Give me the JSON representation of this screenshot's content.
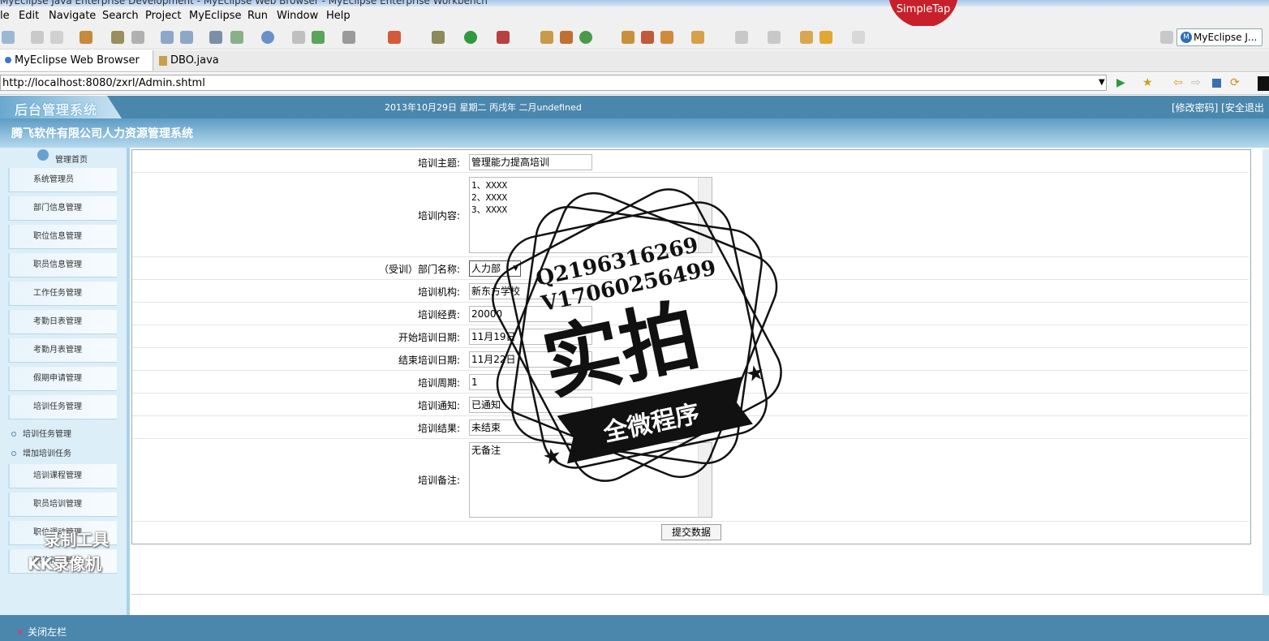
{
  "window": {
    "title": "MyEclipse Java Enterprise Development - MyEclipse Web Browser - MyEclipse Enterprise Workbench"
  },
  "menu": [
    "le",
    "Edit",
    "Navigate",
    "Search",
    "Project",
    "MyEclipse",
    "Run",
    "Window",
    "Help"
  ],
  "simpletap": "SimpleTap",
  "perspective": "MyEclipse J...",
  "tabs": [
    {
      "label": "MyEclipse Web Browser",
      "close": "✕"
    },
    {
      "label": "DBO.java"
    }
  ],
  "address": "http://localhost:8080/zxrl/Admin.shtml",
  "header": {
    "logo": "后台管理系统",
    "date": "2013年10月29日 星期二 丙戌年 二月undefined",
    "links": "[修改密码] [安全退出",
    "system_title": "腾飞软件有限公司人力资源管理系统"
  },
  "sidebar": {
    "home": "管理首页",
    "items": [
      "系统管理员",
      "部门信息管理",
      "职位信息管理",
      "职员信息管理",
      "工作任务管理",
      "考勤日表管理",
      "考勤月表管理",
      "假期申请管理",
      "培训任务管理"
    ],
    "sub_items": [
      "培训任务管理",
      "增加培训任务"
    ],
    "items2": [
      "培训课程管理",
      "职员培训管理",
      "职位调动管理",
      "职位任务管理"
    ],
    "close": "关闭左栏"
  },
  "form": {
    "topic_label": "培训主题:",
    "topic": "管理能力提高培训",
    "content_label": "培训内容:",
    "content_lines": [
      "1、XXXX",
      "2、XXXX",
      "3、XXXX"
    ],
    "dept_label": "（受训）部门名称:",
    "dept": "人力部",
    "org_label": "培训机构:",
    "org": "新东方学校",
    "fee_label": "培训经费:",
    "fee": "20000",
    "start_label": "开始培训日期:",
    "start": "11月19日",
    "end_label": "结束培训日期:",
    "end": "11月22日",
    "period_label": "培训周期:",
    "period": "1",
    "notice_label": "培训通知:",
    "notice": "已通知",
    "result_label": "培训结果:",
    "result": "未结束",
    "remark_label": "培训备注:",
    "remark": "无备注",
    "submit": "提交数据"
  },
  "watermark": {
    "qq": "Q2196316269",
    "vx": "V17060256499",
    "big": "实拍",
    "ribbon": "全微程序"
  },
  "recorder": {
    "line1": "录制工具",
    "line2": "KK录像机"
  }
}
